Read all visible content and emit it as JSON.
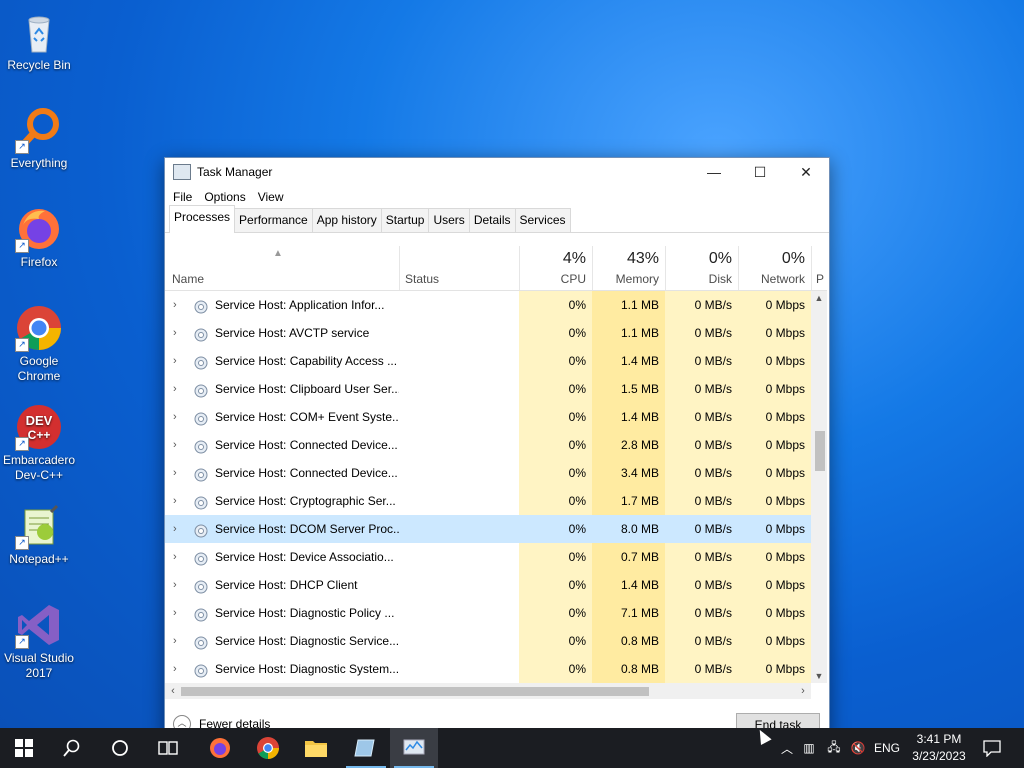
{
  "desktop": {
    "icons": [
      {
        "label": "Recycle Bin"
      },
      {
        "label": "Everything"
      },
      {
        "label": "Firefox"
      },
      {
        "label": "Google Chrome"
      },
      {
        "label": "Embarcadero Dev-C++"
      },
      {
        "label": "Notepad++"
      },
      {
        "label": "Visual Studio 2017"
      }
    ]
  },
  "window": {
    "title": "Task Manager",
    "controls": {
      "minimize": "—",
      "maximize": "☐",
      "close": "✕"
    },
    "menu": [
      "File",
      "Options",
      "View"
    ],
    "tabs": [
      "Processes",
      "Performance",
      "App history",
      "Startup",
      "Users",
      "Details",
      "Services"
    ],
    "active_tab": "Processes",
    "columns": {
      "name": "Name",
      "status": "Status",
      "cpu": {
        "pct": "4%",
        "label": "CPU"
      },
      "memory": {
        "pct": "43%",
        "label": "Memory"
      },
      "disk": {
        "pct": "0%",
        "label": "Disk"
      },
      "network": {
        "pct": "0%",
        "label": "Network"
      },
      "power": "P"
    },
    "rows": [
      {
        "name": "Service Host: Application Infor...",
        "cpu": "0%",
        "mem": "1.1 MB",
        "disk": "0 MB/s",
        "net": "0 Mbps"
      },
      {
        "name": "Service Host: AVCTP service",
        "cpu": "0%",
        "mem": "1.1 MB",
        "disk": "0 MB/s",
        "net": "0 Mbps"
      },
      {
        "name": "Service Host: Capability Access ...",
        "cpu": "0%",
        "mem": "1.4 MB",
        "disk": "0 MB/s",
        "net": "0 Mbps"
      },
      {
        "name": "Service Host: Clipboard User Ser...",
        "cpu": "0%",
        "mem": "1.5 MB",
        "disk": "0 MB/s",
        "net": "0 Mbps"
      },
      {
        "name": "Service Host: COM+ Event Syste...",
        "cpu": "0%",
        "mem": "1.4 MB",
        "disk": "0 MB/s",
        "net": "0 Mbps"
      },
      {
        "name": "Service Host: Connected Device...",
        "cpu": "0%",
        "mem": "2.8 MB",
        "disk": "0 MB/s",
        "net": "0 Mbps"
      },
      {
        "name": "Service Host: Connected Device...",
        "cpu": "0%",
        "mem": "3.4 MB",
        "disk": "0 MB/s",
        "net": "0 Mbps"
      },
      {
        "name": "Service Host: Cryptographic Ser...",
        "cpu": "0%",
        "mem": "1.7 MB",
        "disk": "0 MB/s",
        "net": "0 Mbps"
      },
      {
        "name": "Service Host: DCOM Server Proc...",
        "cpu": "0%",
        "mem": "8.0 MB",
        "disk": "0 MB/s",
        "net": "0 Mbps",
        "selected": true
      },
      {
        "name": "Service Host: Device Associatio...",
        "cpu": "0%",
        "mem": "0.7 MB",
        "disk": "0 MB/s",
        "net": "0 Mbps"
      },
      {
        "name": "Service Host: DHCP Client",
        "cpu": "0%",
        "mem": "1.4 MB",
        "disk": "0 MB/s",
        "net": "0 Mbps"
      },
      {
        "name": "Service Host: Diagnostic Policy ...",
        "cpu": "0%",
        "mem": "7.1 MB",
        "disk": "0 MB/s",
        "net": "0 Mbps"
      },
      {
        "name": "Service Host: Diagnostic Service...",
        "cpu": "0%",
        "mem": "0.8 MB",
        "disk": "0 MB/s",
        "net": "0 Mbps"
      },
      {
        "name": "Service Host: Diagnostic System...",
        "cpu": "0%",
        "mem": "0.8 MB",
        "disk": "0 MB/s",
        "net": "0 Mbps"
      }
    ],
    "footer": {
      "fewer_details": "Fewer details",
      "end_task": "End task"
    }
  },
  "taskbar": {
    "tray_lang": "ENG",
    "time": "3:41 PM",
    "date": "3/23/2023"
  },
  "colors": {
    "accent": "#0078d7",
    "cpu_fill": "#fff4c4",
    "mem_fill": "#ffeba1",
    "selected": "#cce8ff"
  }
}
